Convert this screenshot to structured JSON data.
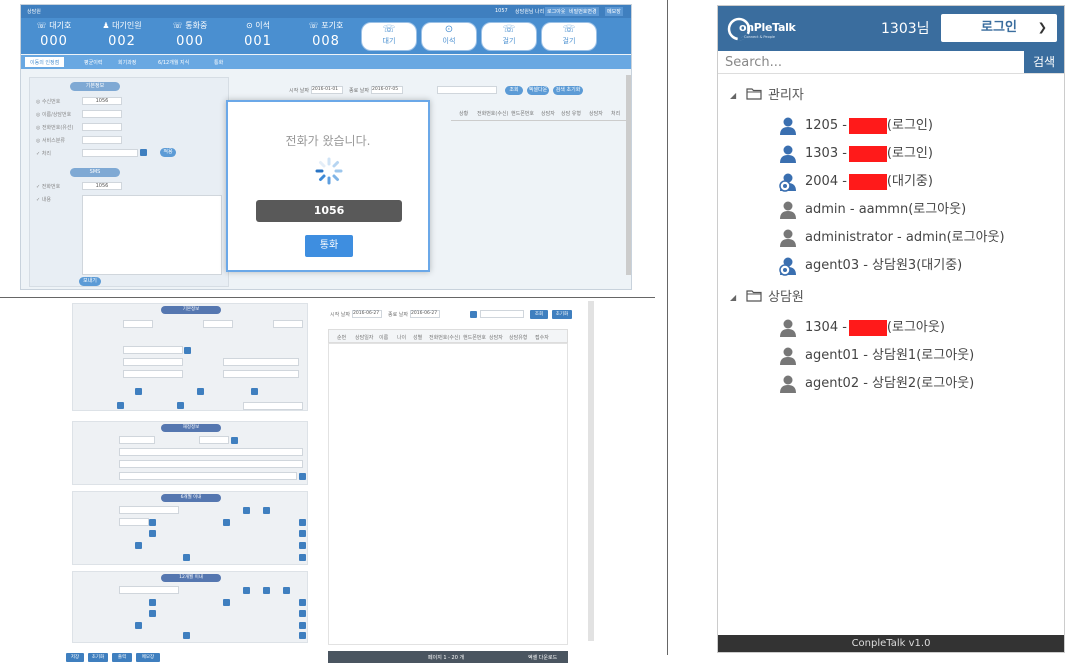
{
  "app1": {
    "title": "상담원",
    "top_right": [
      "1057",
      "상담원님 나리",
      "로그아웃",
      "비밀번호변경",
      "메모장"
    ],
    "stats": [
      {
        "label": "대기호",
        "value": "000"
      },
      {
        "label": "대기인원",
        "value": "002"
      },
      {
        "label": "통화중",
        "value": "000"
      },
      {
        "label": "이석",
        "value": "001"
      },
      {
        "label": "포기호",
        "value": "008"
      }
    ],
    "status_buttons": [
      "대기",
      "이석",
      "걸기",
      "걸기"
    ],
    "tabs": [
      "이동의 인정점",
      "평균이력",
      "회기과정",
      "6/12개월 지식",
      "통화"
    ],
    "left_form": {
      "section1": "기본정보",
      "section2": "SMS",
      "phone": "1056",
      "sms_phone": "1056",
      "apply_btn": "적용"
    },
    "search_row": {
      "start_label": "시작 날짜",
      "start_date": "2016-01-01",
      "end_label": "종료 날짜",
      "end_date": "2016-07-05",
      "btns": [
        "조회",
        "엑셀다운",
        "검색 초기화"
      ]
    },
    "table_headers": [
      "상황",
      "전화번호(수신)",
      "핸드폰번호",
      "상담자",
      "상담 유형",
      "상담자",
      "처리"
    ],
    "modal": {
      "message": "전화가 왔습니다.",
      "number": "1056",
      "call_btn": "통화"
    },
    "sms_footer_btn": "보내기"
  },
  "app2": {
    "search": {
      "start_label": "시작 날짜",
      "start_date": "2016-06-27",
      "end_label": "종료 날짜",
      "end_date": "2016-06-27",
      "btns": [
        "조회",
        "초기화"
      ]
    },
    "table_headers": [
      "순번",
      "상담일자",
      "이름",
      "나이",
      "성별",
      "전화번호(수신)",
      "핸드폰번호",
      "상담자",
      "상담유형",
      "접수자"
    ],
    "sections": [
      "기본정보",
      "재정정보",
      "6개월 이내",
      "12개월 이내"
    ],
    "bottom_btns": [
      "저장",
      "초기화",
      "출력",
      "메모장"
    ],
    "pager": "페이지 1 - 20 개",
    "footer_right": "엑셀 다운로드"
  },
  "app3": {
    "user_label": "1303님",
    "login_btn": "로그인",
    "search_placeholder": "Search...",
    "search_btn": "검색",
    "logo_text": "onPleTalk",
    "logo_sub": "Connect & People",
    "groups": [
      {
        "name": "관리자",
        "members": [
          {
            "text_a": "1205 -",
            "text_b": "(로그인)",
            "icon": "person-icon",
            "redacted": true
          },
          {
            "text_a": "1303 -",
            "text_b": "(로그인)",
            "icon": "person-icon",
            "redacted": true
          },
          {
            "text_a": "2004 -",
            "text_b": "(대기중)",
            "icon": "person-gear-icon",
            "redacted": true
          },
          {
            "text_a": "admin - aammn(로그아웃)",
            "text_b": "",
            "icon": "person-offline-icon",
            "redacted": false
          },
          {
            "text_a": "administrator - admin(로그아웃)",
            "text_b": "",
            "icon": "person-offline-icon",
            "redacted": false
          },
          {
            "text_a": "agent03 - 상담원3(대기중)",
            "text_b": "",
            "icon": "person-gear-icon",
            "redacted": false
          }
        ]
      },
      {
        "name": "상담원",
        "members": [
          {
            "text_a": "1304 -",
            "text_b": "(로그아웃)",
            "icon": "person-offline-icon",
            "redacted": true
          },
          {
            "text_a": "agent01 - 상담원1(로그아웃)",
            "text_b": "",
            "icon": "person-offline-icon",
            "redacted": false
          },
          {
            "text_a": "agent02 - 상담원2(로그아웃)",
            "text_b": "",
            "icon": "person-offline-icon",
            "redacted": false
          }
        ]
      }
    ],
    "footer": "ConpleTalk v1.0"
  },
  "colors": {
    "primary": "#3a6d9e",
    "accent": "#4a8fd0",
    "redact": "#ff1a1a"
  }
}
